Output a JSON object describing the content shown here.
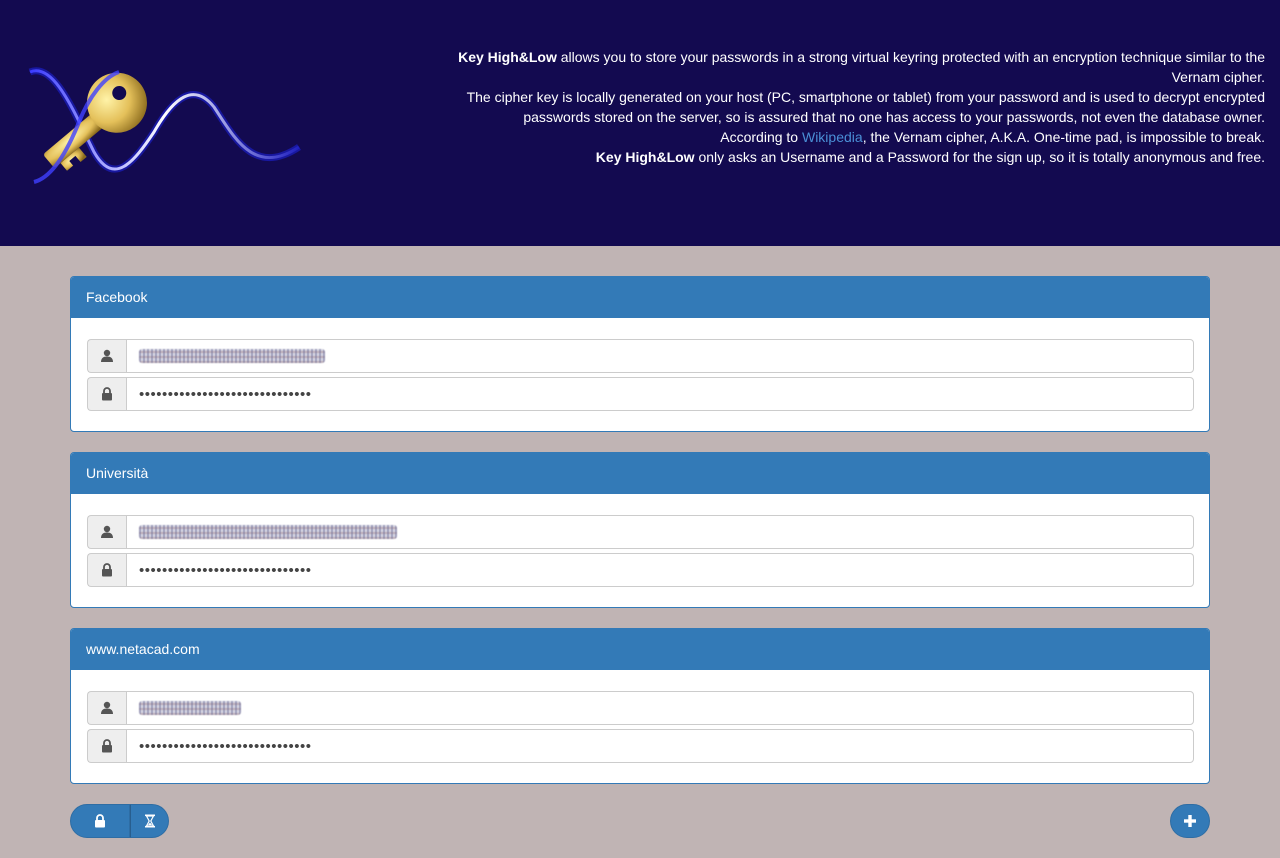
{
  "header": {
    "brand": "Key High&Low",
    "lines": [
      {
        "bold": "Key High&Low",
        "text": " allows you to store your passwords in a strong virtual keyring protected with an encryption technique similar to the Vernam cipher."
      },
      {
        "bold": "",
        "text": "The cipher key is locally generated on your host (PC, smartphone or tablet) from your password and is used to decrypt encrypted passwords stored on the server, so is assured that no one has access to your passwords, not even the database owner."
      },
      {
        "bold": "Key High&Low",
        "text": " only asks an Username and a Password for the sign up, so it is totally anonymous and free."
      }
    ],
    "wiki_prefix": "According to ",
    "wiki_link": "Wikipedia",
    "wiki_suffix": ", the Vernam cipher, A.K.A. One-time pad, is impossible to break."
  },
  "entries": [
    {
      "title": "Facebook",
      "username": "",
      "password": "••••••••••••••••••••••••••••••"
    },
    {
      "title": "Università",
      "username": "",
      "password": "••••••••••••••••••••••••••••••"
    },
    {
      "title": "www.netacad.com",
      "username": "",
      "password": "••••••••••••••••••••••••••••••"
    }
  ],
  "icons": {
    "user": "user-icon",
    "lock": "lock-icon",
    "hourglass": "hourglass-icon",
    "plus": "plus-icon"
  },
  "colors": {
    "header_bg": "#130a50",
    "page_bg": "#c0b4b4",
    "primary": "#337ab7",
    "link": "#4a8fd6"
  }
}
